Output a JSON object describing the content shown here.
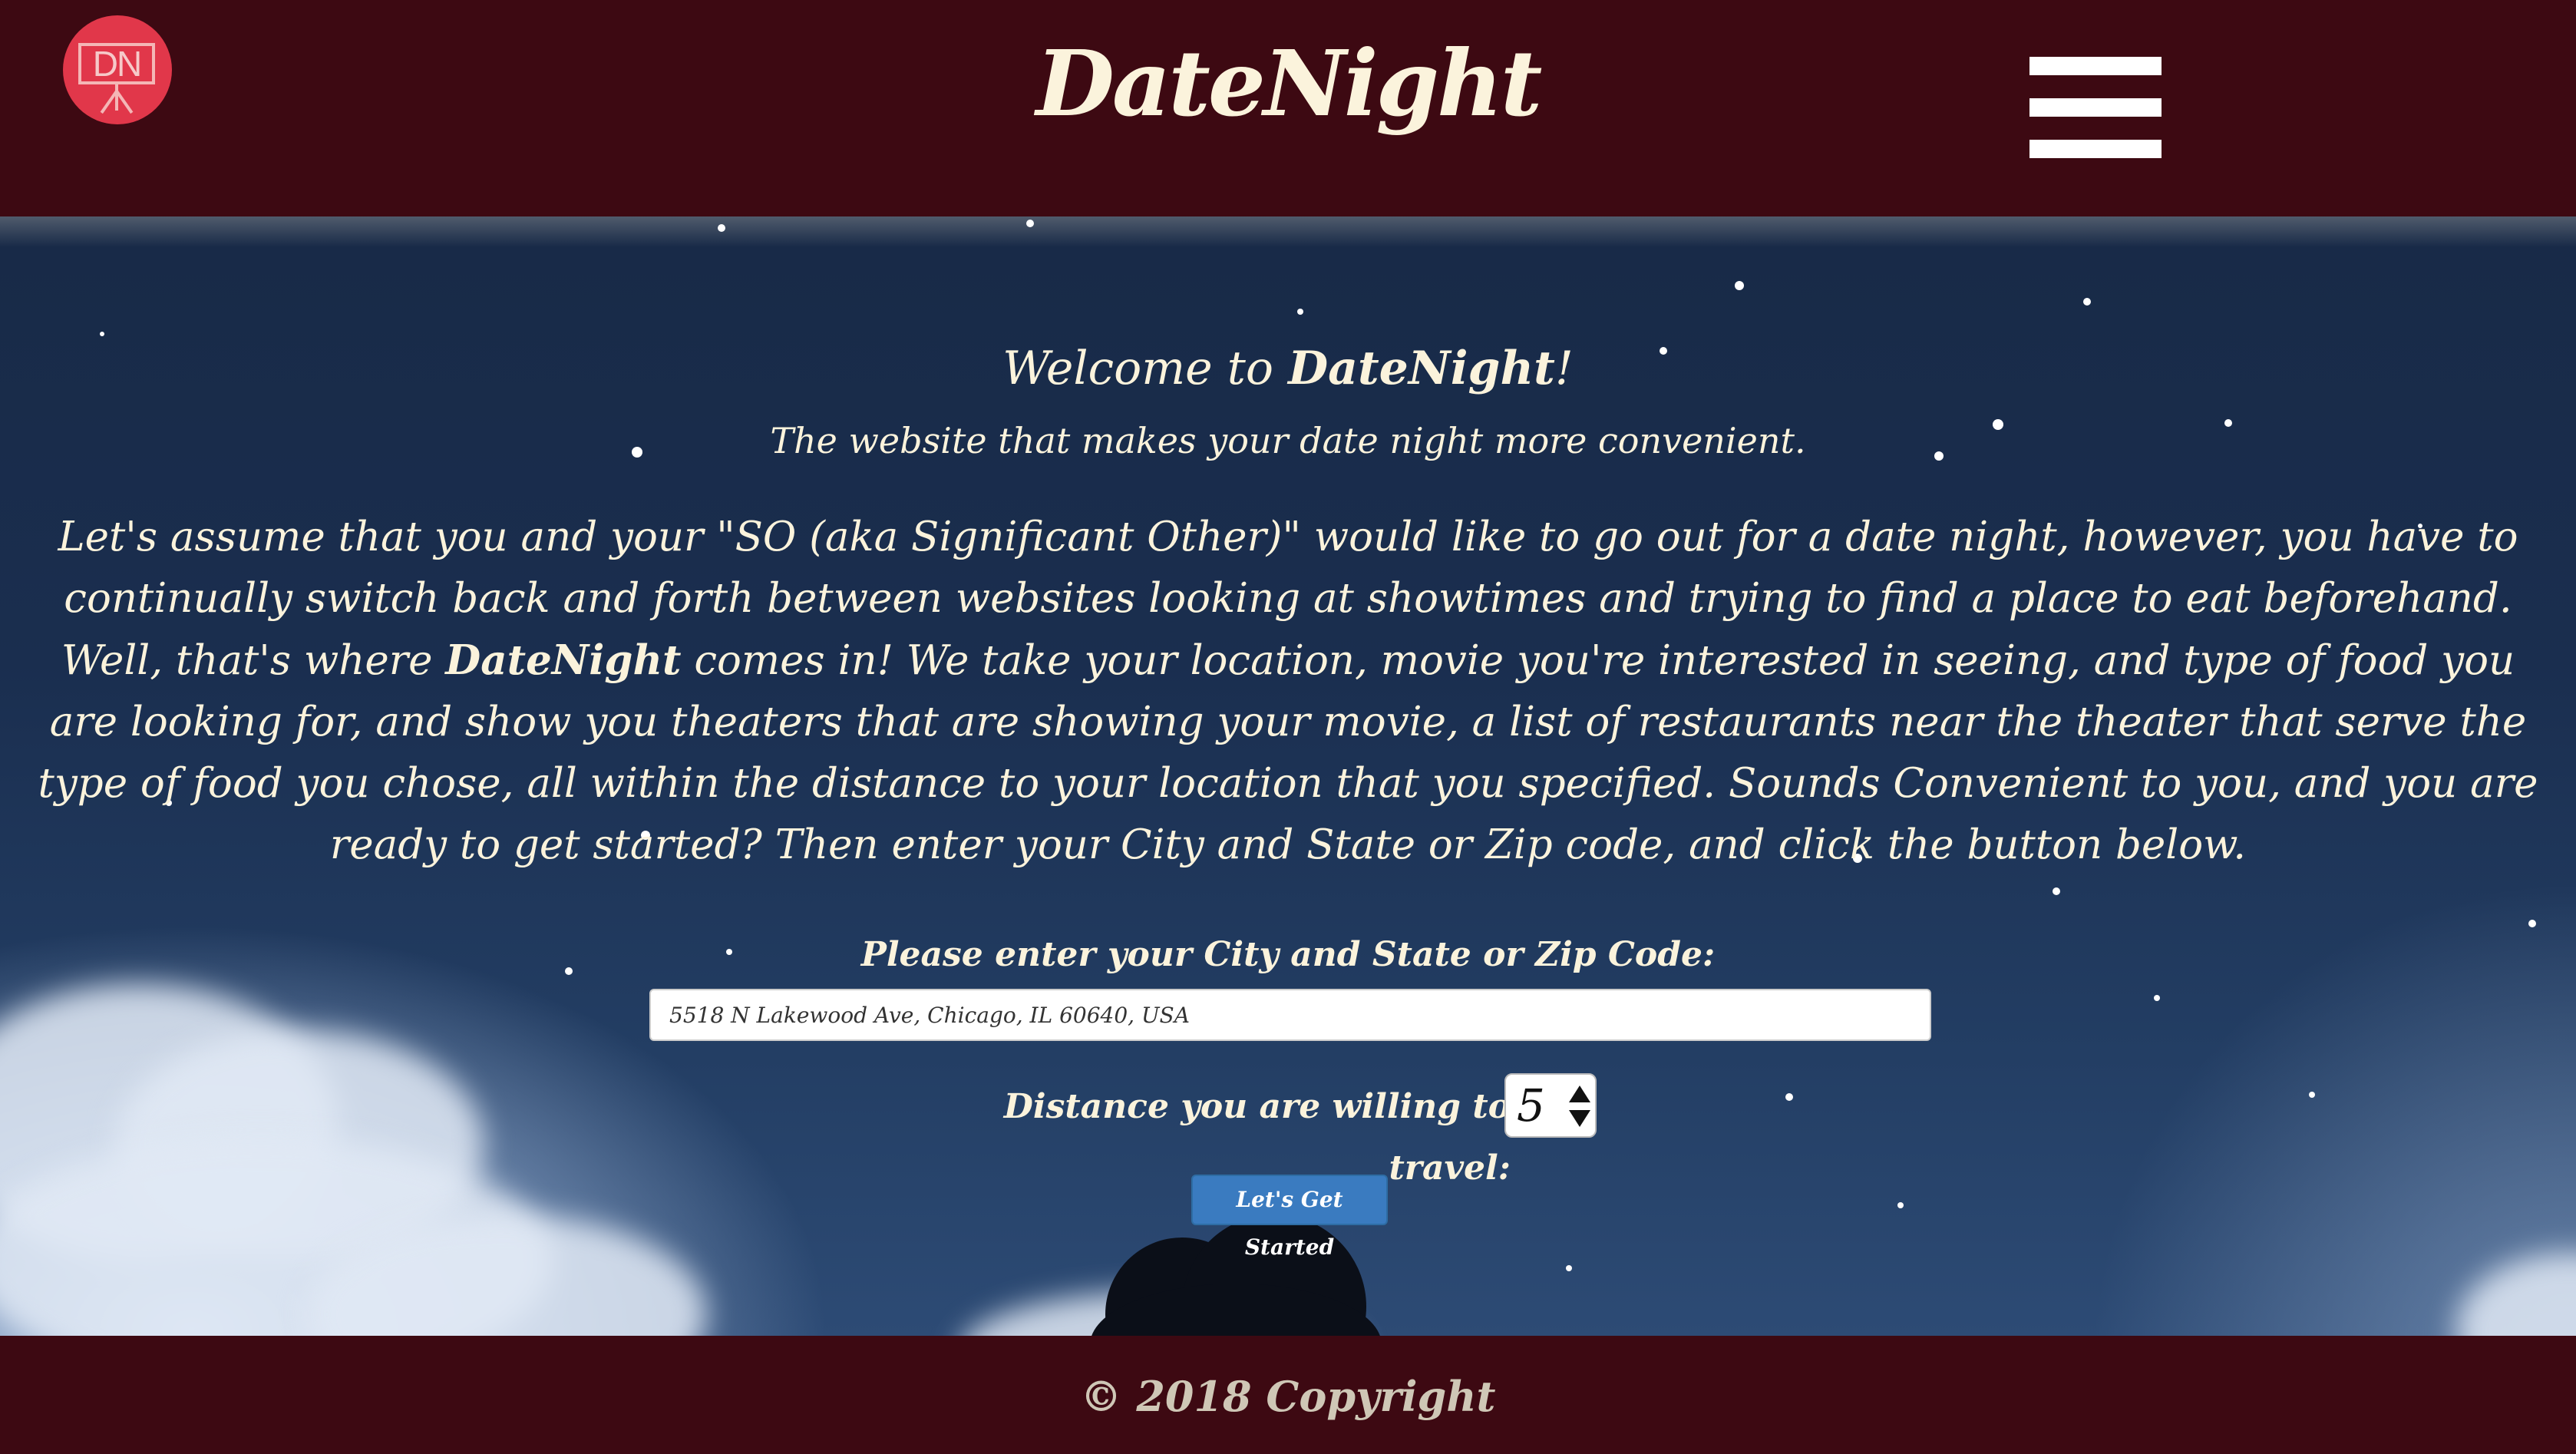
{
  "header": {
    "logo_text": "DN",
    "title": "DateNight",
    "menu_icon": "hamburger-menu-icon"
  },
  "hero": {
    "welcome_prefix": "Welcome to ",
    "welcome_brand": "DateNight",
    "welcome_suffix": "!",
    "tagline": "The website that makes your date night more convenient.",
    "intro_part1": "Let's assume that you and your \"SO (aka Significant Other)\" would like to go out for a date night, however, you have to continually switch back and forth between websites looking at showtimes and trying to find a place to eat beforehand. Well, that's where ",
    "intro_brand": "DateNight",
    "intro_part2": " comes in! We take your location, movie you're interested in seeing, and type of food you are looking for, and show you theaters that are showing your movie, a list of restaurants near the theater that serve the type of food you chose, all within the distance to your location that you specified. Sounds Convenient to you, and you are ready to get started? Then enter your City and State or Zip code, and click the button below."
  },
  "form": {
    "location_label": "Please enter your City and State or Zip Code:",
    "location_value": "5518 N Lakewood Ave, Chicago, IL 60640, USA",
    "distance_label": "Distance you are willing to travel:",
    "distance_value": "5",
    "start_button": "Let's Get Started"
  },
  "footer": {
    "copyright": "© 2018 Copyright"
  },
  "colors": {
    "header_bg": "#3d0912",
    "title_text": "#fbf3dc",
    "logo_bg": "#e1374a",
    "button_bg": "#3a7bc0",
    "sky": "#1a2e4f"
  }
}
